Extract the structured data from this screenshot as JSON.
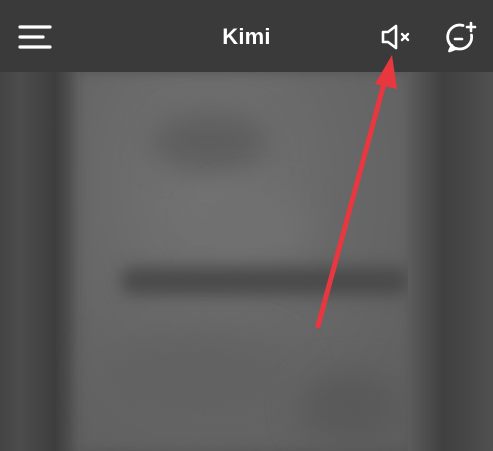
{
  "header": {
    "title": "Kimi",
    "left_icon": "menu-icon",
    "right_icons": [
      "speaker-mute-icon",
      "new-chat-icon"
    ]
  },
  "colors": {
    "header_background": "#3a3a3a",
    "title_text": "#ffffff",
    "icon": "#ffffff",
    "annotation_arrow": "#e8373f"
  }
}
